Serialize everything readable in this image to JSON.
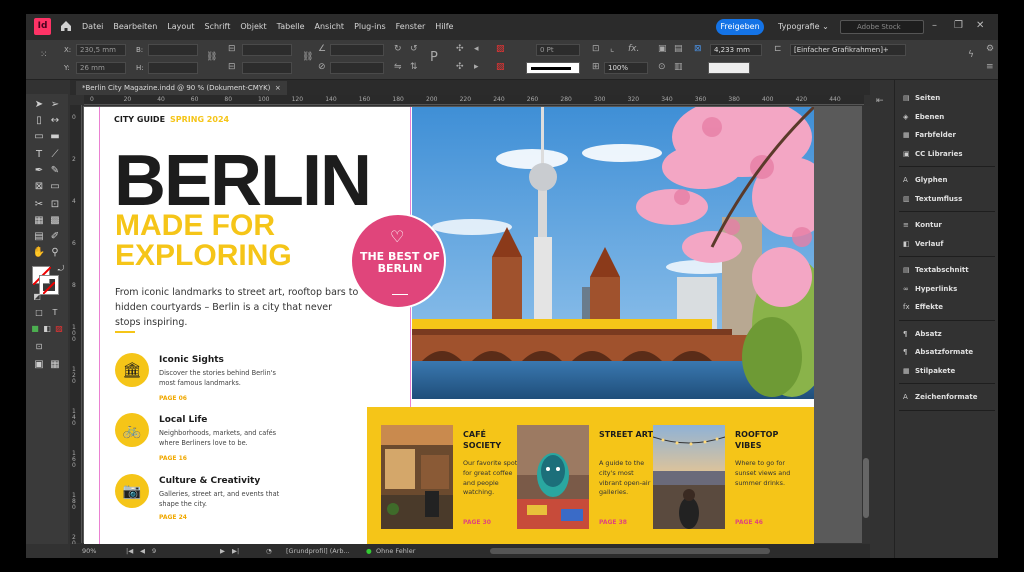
{
  "menubar": {
    "app_logo": "Id",
    "items": [
      "Datei",
      "Bearbeiten",
      "Layout",
      "Schrift",
      "Objekt",
      "Tabelle",
      "Ansicht",
      "Plug-ins",
      "Fenster",
      "Hilfe"
    ],
    "share_label": "Freigeben",
    "workspace": "Typografie",
    "stock_placeholder": "Adobe Stock"
  },
  "control": {
    "x_label": "X:",
    "y_label": "Y:",
    "b_label": "B:",
    "h_label": "H:",
    "x_value": "230,5 mm",
    "y_value": "26 mm",
    "stroke_weight": "0 Pt",
    "scale": "100%",
    "dimension": "4,233 mm",
    "frame_style": "[Einfacher Grafikrahmen]+"
  },
  "document": {
    "tab_title": "*Berlin City Magazine.indd @ 90 % (Dokument-CMYK)",
    "close": "×"
  },
  "ruler": {
    "h_ticks": [
      "0",
      "20",
      "40",
      "60",
      "80",
      "100",
      "120",
      "140",
      "160",
      "180",
      "200",
      "220",
      "240",
      "260",
      "280",
      "300",
      "320",
      "340",
      "360",
      "380",
      "400",
      "420",
      "440"
    ],
    "v_ticks": [
      "0",
      "2",
      "4",
      "6",
      "8",
      "1 0 0",
      "1 2 0",
      "1 4 0",
      "1 6 0",
      "1 8 0",
      "2 0 0"
    ]
  },
  "page": {
    "city_guide": "CITY GUIDE",
    "season": "SPRING 2024",
    "title": "BERLIN",
    "subtitle": "MADE FOR EXPLORING",
    "intro": "From iconic landmarks to street art, rooftop bars to hidden courtyards – Berlin is a city that never stops inspiring.",
    "badge": "THE BEST OF BERLIN",
    "features": [
      {
        "title": "Iconic Sights",
        "desc": "Discover the stories behind Berlin's most famous landmarks.",
        "page": "PAGE 06",
        "icon": "🏛"
      },
      {
        "title": "Local Life",
        "desc": "Neighborhoods, markets, and cafés where Berliners love to be.",
        "page": "PAGE 16",
        "icon": "🚲"
      },
      {
        "title": "Culture & Creativity",
        "desc": "Galleries, street art, and events that shape the city.",
        "page": "PAGE 24",
        "icon": "📷"
      }
    ],
    "cards": [
      {
        "title": "CAFÉ SOCIETY",
        "desc": "Our favorite spots for great coffee and people watching.",
        "page": "PAGE 30"
      },
      {
        "title": "STREET ART",
        "desc": "A guide to the city's most vibrant open-air galleries.",
        "page": "PAGE 38"
      },
      {
        "title": "ROOFTOP VIBES",
        "desc": "Where to go for sunset views and summer drinks.",
        "page": "PAGE 46"
      }
    ]
  },
  "panels": [
    {
      "label": "Seiten",
      "icon": "▤"
    },
    {
      "label": "Ebenen",
      "icon": "◈"
    },
    {
      "label": "Farbfelder",
      "icon": "▦"
    },
    {
      "label": "CC Libraries",
      "icon": "▣"
    },
    {
      "label": "Glyphen",
      "icon": "A"
    },
    {
      "label": "Textumfluss",
      "icon": "▥"
    },
    {
      "label": "Kontur",
      "icon": "≡"
    },
    {
      "label": "Verlauf",
      "icon": "◧"
    },
    {
      "label": "Textabschnitt",
      "icon": "▤"
    },
    {
      "label": "Hyperlinks",
      "icon": "∞"
    },
    {
      "label": "Effekte",
      "icon": "fx"
    },
    {
      "label": "Absatz",
      "icon": "¶"
    },
    {
      "label": "Absatzformate",
      "icon": "¶"
    },
    {
      "label": "Stilpakete",
      "icon": "▦"
    },
    {
      "label": "Zeichenformate",
      "icon": "A"
    }
  ],
  "status": {
    "zoom": "90%",
    "page_num": "9",
    "profile": "[Grundprofil] (Arb...",
    "errors": "Ohne Fehler"
  }
}
